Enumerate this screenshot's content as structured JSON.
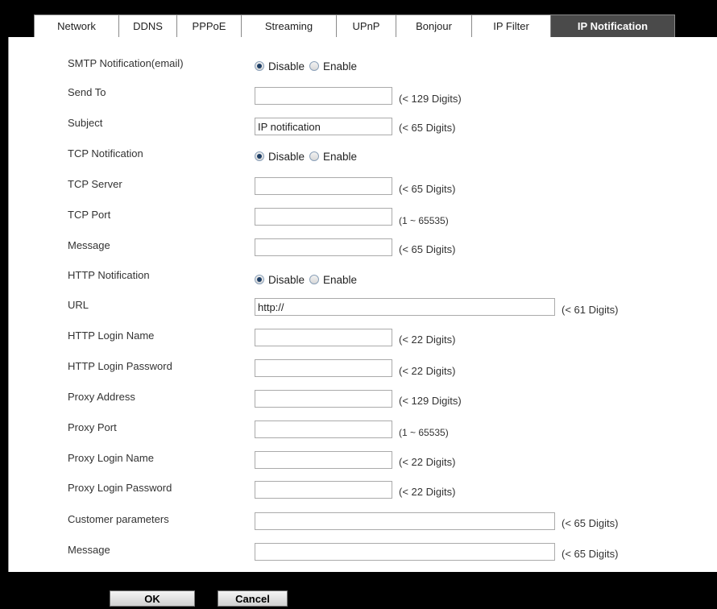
{
  "tabs": [
    {
      "label": "Network"
    },
    {
      "label": "DDNS"
    },
    {
      "label": "PPPoE"
    },
    {
      "label": "Streaming"
    },
    {
      "label": "UPnP"
    },
    {
      "label": "Bonjour"
    },
    {
      "label": "IP Filter"
    },
    {
      "label": "IP Notification"
    }
  ],
  "active_tab": "IP Notification",
  "radio_options": {
    "disable": "Disable",
    "enable": "Enable"
  },
  "rows": {
    "smtp": {
      "label": "SMTP Notification(email)",
      "selected": "Disable"
    },
    "send_to": {
      "label": "Send To",
      "value": "",
      "hint": "(< 129 Digits)"
    },
    "subject": {
      "label": "Subject",
      "value": "IP notification",
      "hint": "(< 65 Digits)"
    },
    "tcp": {
      "label": "TCP Notification",
      "selected": "Disable"
    },
    "tcp_server": {
      "label": "TCP Server",
      "value": "",
      "hint": "(< 65 Digits)"
    },
    "tcp_port": {
      "label": "TCP Port",
      "value": "",
      "hint": "(1 ~ 65535)"
    },
    "tcp_message": {
      "label": "Message",
      "value": "",
      "hint": "(< 65 Digits)"
    },
    "http": {
      "label": "HTTP Notification",
      "selected": "Disable"
    },
    "url": {
      "label": "URL",
      "value": "http://",
      "hint": "(< 61 Digits)"
    },
    "http_login_name": {
      "label": "HTTP Login Name",
      "value": "",
      "hint": "(< 22 Digits)"
    },
    "http_login_password": {
      "label": "HTTP Login Password",
      "value": "",
      "hint": "(< 22 Digits)"
    },
    "proxy_address": {
      "label": "Proxy Address",
      "value": "",
      "hint": "(< 129 Digits)"
    },
    "proxy_port": {
      "label": "Proxy Port",
      "value": "",
      "hint": "(1 ~ 65535)"
    },
    "proxy_login_name": {
      "label": "Proxy Login Name",
      "value": "",
      "hint": "(< 22 Digits)"
    },
    "proxy_login_password": {
      "label": "Proxy Login Password",
      "value": "",
      "hint": "(< 22 Digits)"
    },
    "customer_parameters": {
      "label": "Customer parameters",
      "value": "",
      "hint": "(< 65 Digits)"
    },
    "http_message": {
      "label": "Message",
      "value": "",
      "hint": "(< 65 Digits)"
    }
  },
  "buttons": {
    "ok": "OK",
    "cancel": "Cancel"
  }
}
